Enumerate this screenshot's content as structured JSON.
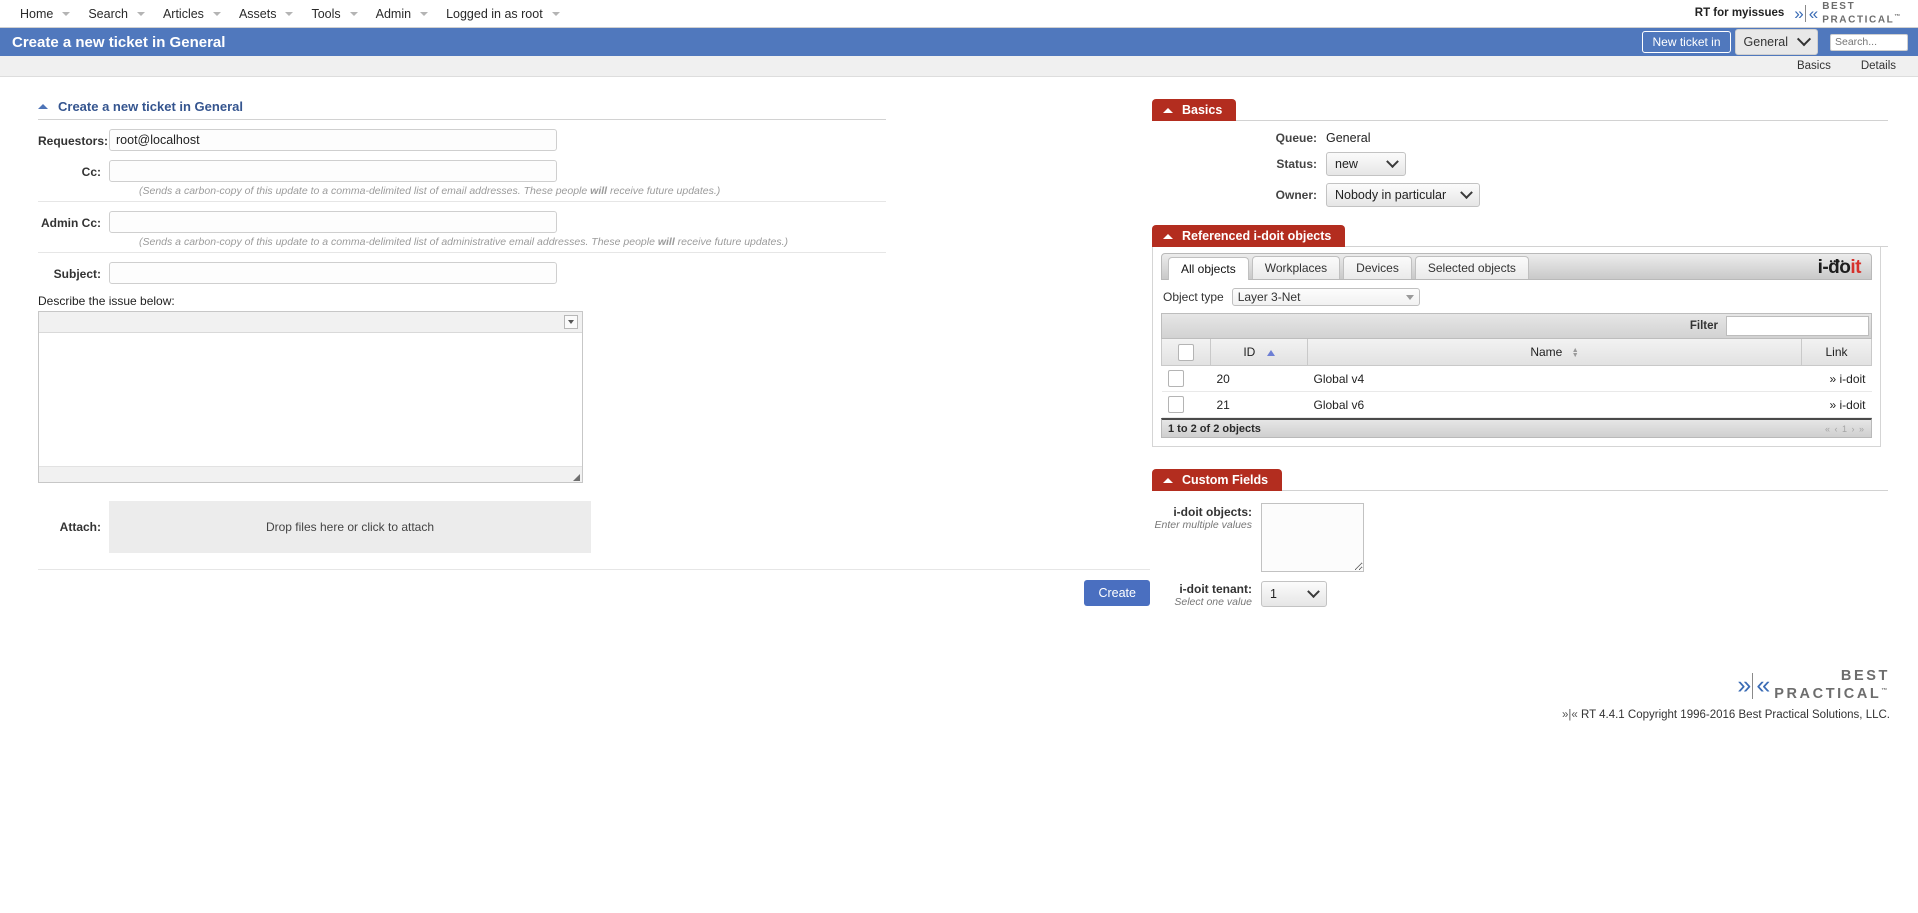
{
  "topnav": {
    "items": [
      {
        "label": "Home",
        "has_caret": true
      },
      {
        "label": "Search",
        "has_caret": true
      },
      {
        "label": "Articles",
        "has_caret": true
      },
      {
        "label": "Assets",
        "has_caret": true
      },
      {
        "label": "Tools",
        "has_caret": true
      },
      {
        "label": "Admin",
        "has_caret": true
      },
      {
        "label": "Logged in as root",
        "has_caret": true
      }
    ],
    "rt_for": "RT for myissues",
    "brand_line1": "BEST",
    "brand_line2": "PRACTICAL",
    "brand_tm": "™"
  },
  "titlebar": {
    "title": "Create a new ticket in General",
    "new_ticket_label": "New ticket in",
    "queue_value": "General",
    "search_placeholder": "Search..."
  },
  "subbar": {
    "basics": "Basics",
    "details": "Details"
  },
  "form": {
    "section_title": "Create a new ticket in General",
    "requestors_label": "Requestors:",
    "requestors_value": "root@localhost",
    "cc_label": "Cc:",
    "cc_value": "",
    "cc_hint": "(Sends a carbon-copy of this update to a comma-delimited list of email addresses. These people will receive future updates.)",
    "cc_hint_pre": "(Sends a carbon-copy of this update to a comma-delimited list of email addresses. These people ",
    "cc_hint_bold": "will",
    "cc_hint_post": " receive future updates.)",
    "admincc_label": "Admin Cc:",
    "admincc_value": "",
    "admincc_hint_pre": "(Sends a carbon-copy of this update to a comma-delimited list of administrative email addresses. These people ",
    "admincc_hint_bold": "will",
    "admincc_hint_post": " receive future updates.)",
    "subject_label": "Subject:",
    "subject_value": "",
    "describe_label": "Describe the issue below:",
    "message_value": "",
    "attach_label": "Attach:",
    "dropzone_text": "Drop files here or click to attach",
    "create_label": "Create"
  },
  "basics": {
    "title": "Basics",
    "queue_label": "Queue:",
    "queue_value": "General",
    "status_label": "Status:",
    "status_value": "new",
    "owner_label": "Owner:",
    "owner_value": "Nobody in particular"
  },
  "idoit": {
    "title": "Referenced i-doit objects",
    "tabs": [
      {
        "label": "All objects",
        "active": true
      },
      {
        "label": "Workplaces",
        "active": false
      },
      {
        "label": "Devices",
        "active": false
      },
      {
        "label": "Selected objects",
        "active": false
      }
    ],
    "logo_dark": "i-do",
    "logo_red": "it",
    "objtype_label": "Object type",
    "objtype_value": "Layer 3-Net",
    "filter_label": "Filter",
    "filter_value": "",
    "columns": [
      "",
      "ID",
      "Name",
      "Link"
    ],
    "rows": [
      {
        "id": "20",
        "name": "Global v4",
        "link": "» i-doit"
      },
      {
        "id": "21",
        "name": "Global v6",
        "link": "» i-doit"
      }
    ],
    "footer_count": "1 to 2 of 2 objects",
    "pager": "« ‹ 1 › »"
  },
  "custom_fields": {
    "title": "Custom Fields",
    "objects_label": "i-doit objects:",
    "objects_sub": "Enter multiple values",
    "objects_value": "",
    "tenant_label": "i-doit tenant:",
    "tenant_sub": "Select one value",
    "tenant_value": "1"
  },
  "footer": {
    "brand_line1": "BEST",
    "brand_line2": "PRACTICAL",
    "brand_tm": "™",
    "copyright_prefix": "»|« ",
    "copyright": "RT 4.4.1 Copyright 1996-2016 Best Practical Solutions, LLC."
  },
  "colors": {
    "title_bar": "#5078bd",
    "widget_red": "#b32d1f",
    "link_blue": "#35558f",
    "create_button": "#4a6fc0",
    "idoit_red": "#d6312b"
  }
}
